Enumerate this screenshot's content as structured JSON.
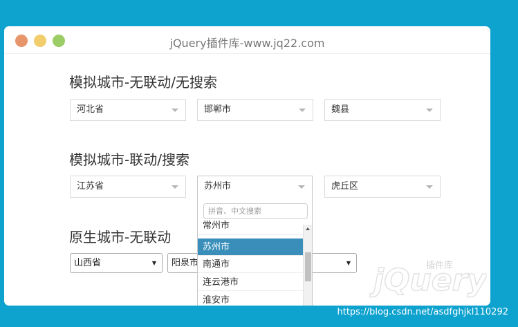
{
  "window": {
    "title": "jQuery插件库-www.jq22.com"
  },
  "section1": {
    "title": "模拟城市-无联动/无搜索",
    "province": "河北省",
    "city": "邯郸市",
    "district": "魏县"
  },
  "section2": {
    "title": "模拟城市-联动/搜索",
    "province": "江苏省",
    "city": "苏州市",
    "district": "虎丘区",
    "dropdown": {
      "search_placeholder": "拼音、中文搜索",
      "options": [
        "常州市",
        "苏州市",
        "南通市",
        "连云港市",
        "淮安市"
      ],
      "selected_index": 1
    }
  },
  "section3": {
    "title": "原生城市-无联动",
    "province": "山西省",
    "city": "阳泉市"
  },
  "logo": {
    "text": "jQuery",
    "subtext": "插件库"
  },
  "watermark": "https://blog.csdn.net/asdfghjkl110292",
  "colors": {
    "background": "#0ea2cf",
    "selected": "#3a8fba"
  }
}
